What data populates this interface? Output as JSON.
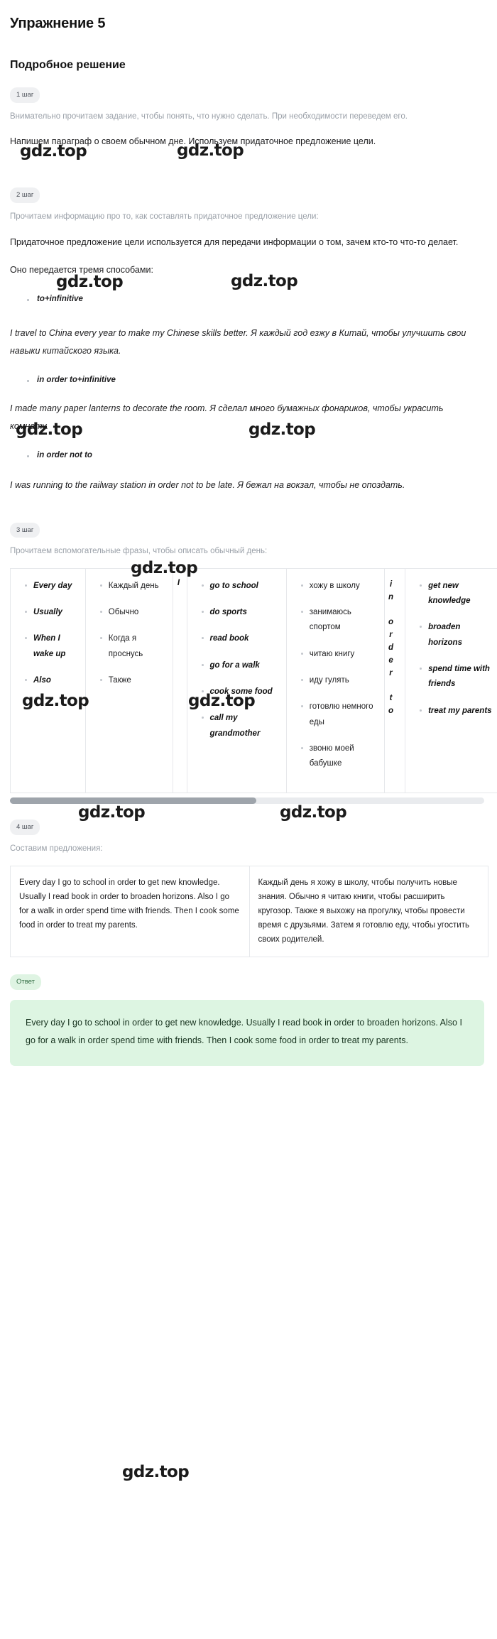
{
  "page": {
    "exercise_title": "Упражнение 5",
    "solution_title": "Подробное решение",
    "watermark_text": "gdz.top"
  },
  "steps": [
    {
      "chip": "1 шаг",
      "hint": "Внимательно прочитаем задание, чтобы понять, что нужно сделать. При необходимости переведем его.",
      "body": "Напишем параграф о своем обычном дне. Используем придаточное предложение цели."
    },
    {
      "chip": "2 шаг",
      "hint": "Прочитаем информацию про то, как составлять придаточное предложение цели:",
      "body": "Придаточное предложение цели используется для передачи информации о том, зачем кто-то что-то делает.",
      "body2": "Оно передается тремя способами:",
      "forms": [
        {
          "label": "to+infinitive",
          "example": "I travel to China every year to make my Chinese skills better. Я каждый год езжу в Китай, чтобы улучшить свои навыки китайского языка."
        },
        {
          "label": "in order to+infinitive",
          "example": "I made many paper lanterns to decorate the room. Я сделал много бумажных фонариков, чтобы украсить комнату."
        },
        {
          "label": "in order not to",
          "example": "I was running to the railway station in order not to be late. Я бежал на вокзал, чтобы не опоздать."
        }
      ]
    },
    {
      "chip": "3 шаг",
      "hint": "Прочитаем вспомогательные фразы, чтобы описать обычный день:",
      "table": {
        "col1_en": [
          "Every day",
          "Usually",
          "When I wake up",
          "Also"
        ],
        "col2_ru": [
          "Каждый день",
          "Обычно",
          "Когда я проснусь",
          "Также"
        ],
        "col3_subject": "I",
        "col4_en": [
          "go to school",
          "do sports",
          "read book",
          "go for a walk",
          "cook some food",
          "call my grandmother"
        ],
        "col5_ru": [
          "хожу в школу",
          "занимаюсь спортом",
          "читаю книгу",
          "иду гулять",
          "готовлю немного еды",
          "звоню моей бабушке"
        ],
        "col6_vertical": "in order to",
        "col7_en": [
          "get new knowledge",
          "broaden horizons",
          "spend time with friends",
          "treat my parents"
        ]
      }
    },
    {
      "chip": "4 шаг",
      "hint": "Составим предложения:",
      "sentence_en": "Every day I go to school in order to get new knowledge. Usually I read book in order to broaden horizons. Also I go for a walk in order spend time with friends. Then I cook some food in order to treat my parents.",
      "sentence_ru": "Каждый день я хожу в школу, чтобы получить новые знания. Обычно я читаю книги, чтобы расширить кругозор. Также я выхожу на прогулку, чтобы провести время с друзьями. Затем я готовлю еду, чтобы угостить своих родителей."
    }
  ],
  "answer": {
    "chip": "Ответ",
    "text": "Every day I go to school in order to get new knowledge. Usually I read book in order to broaden horizons. Also I go for a walk in order spend time with friends. Then I cook some food in order to treat my parents."
  }
}
